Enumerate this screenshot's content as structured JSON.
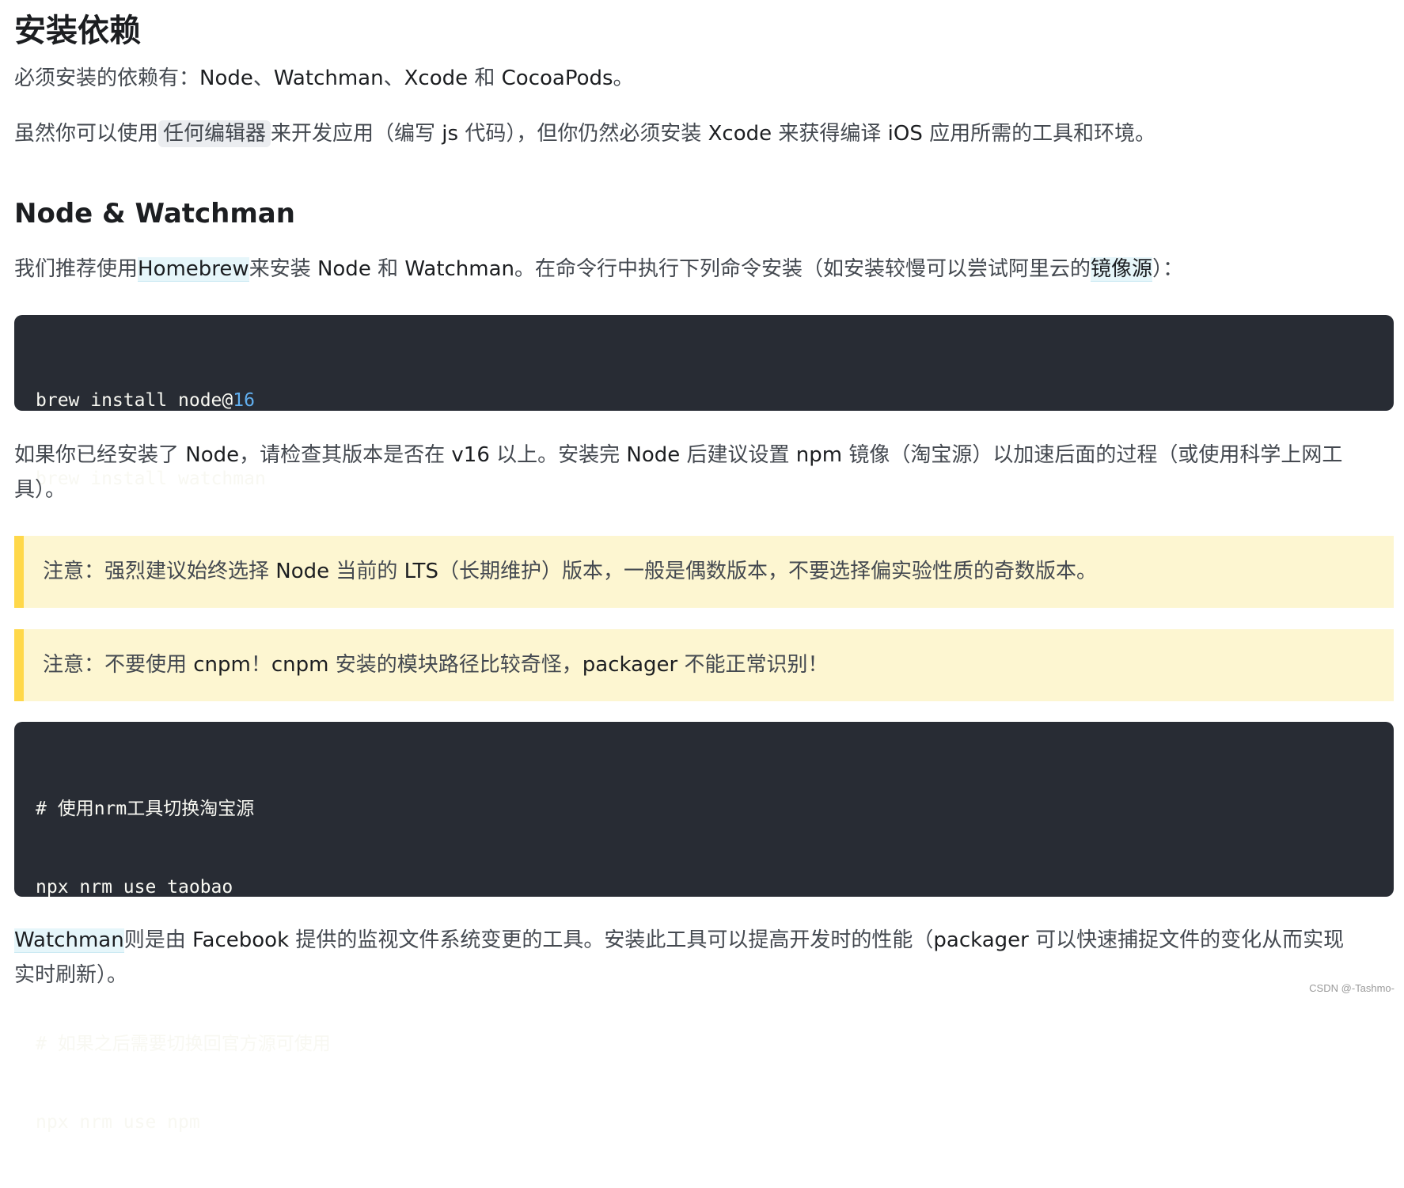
{
  "heading_main": "安装依赖",
  "para_deps": {
    "prefix": "必须安装的依赖有：",
    "node": "Node",
    "sep1": "、",
    "watchman": "Watchman",
    "sep2": "、",
    "xcode": "Xcode",
    "and": " 和 ",
    "cocoapods": "CocoaPods",
    "end": "。"
  },
  "para_editor": {
    "t1": "虽然你可以使用",
    "editor_code": "任何编辑器",
    "t2": "来开发应用（编写 ",
    "js": "js",
    "t3": " 代码），但你仍然必须安装 ",
    "xcode": "Xcode",
    "t4": " 来获得编译 ",
    "ios": "iOS",
    "t5": " 应用所需的工具和环境。"
  },
  "heading_node": "Node & Watchman",
  "para_homebrew": {
    "t1": "我们推荐使用",
    "homebrew_link": "Homebrew",
    "t2": "来安装 ",
    "node": "Node",
    "t3": " 和 ",
    "watchman": "Watchman",
    "t4": "。在命令行中执行下列命令安装（如安装较慢可以尝试阿里云的",
    "mirror_link": "镜像源",
    "t5": "）："
  },
  "code_install": {
    "line1_text": "brew install node@",
    "line1_num": "16",
    "line2": "brew install watchman"
  },
  "para_version": {
    "t1": "如果你已经安装了 ",
    "node1": "Node",
    "t2": "，请检查其版本是否在 ",
    "v16": "v16",
    "t3": " 以上。安装完 ",
    "node2": "Node",
    "t4": " 后建议设置 ",
    "npm": "npm",
    "t5": " 镜像（淘宝源）以加速后面的过程（或使用科学上网工",
    "line2": "具）。"
  },
  "note_lts": {
    "t1": "注意：强烈建议始终选择 ",
    "node": "Node",
    "t2": " 当前的 ",
    "lts": "LTS",
    "t3": "（长期维护）版本，一般是偶数版本，不要选择偏实验性质的奇数版本。"
  },
  "note_cnpm": {
    "t1": "注意：不要使用 ",
    "cnpm1": "cnpm",
    "t2": "！",
    "cnpm2": "cnpm",
    "t3": " 安装的模块路径比较奇怪，",
    "packager": "packager",
    "t4": " 不能正常识别！"
  },
  "code_nrm": {
    "comment1": "# 使用nrm工具切换淘宝源",
    "cmd1": "npx nrm use taobao",
    "comment2": "# 如果之后需要切换回官方源可使用",
    "cmd2": "npx nrm use npm"
  },
  "para_watchman": {
    "watchman_link": "Watchman",
    "t1": "则是由 ",
    "facebook": "Facebook",
    "t2": " 提供的监视文件系统变更的工具。安装此工具可以提高开发时的性能（",
    "packager": "packager",
    "t3": " 可以快速捕捉文件的变化从而实现",
    "line2": "实时刷新）。"
  },
  "watermark": "CSDN @-Tashmo-",
  "colors": {
    "code_bg": "#282c34",
    "note_bg": "#fdf6d1",
    "note_border": "#ffd84a",
    "link_bg": "#e6f6fa",
    "number": "#61afef"
  }
}
